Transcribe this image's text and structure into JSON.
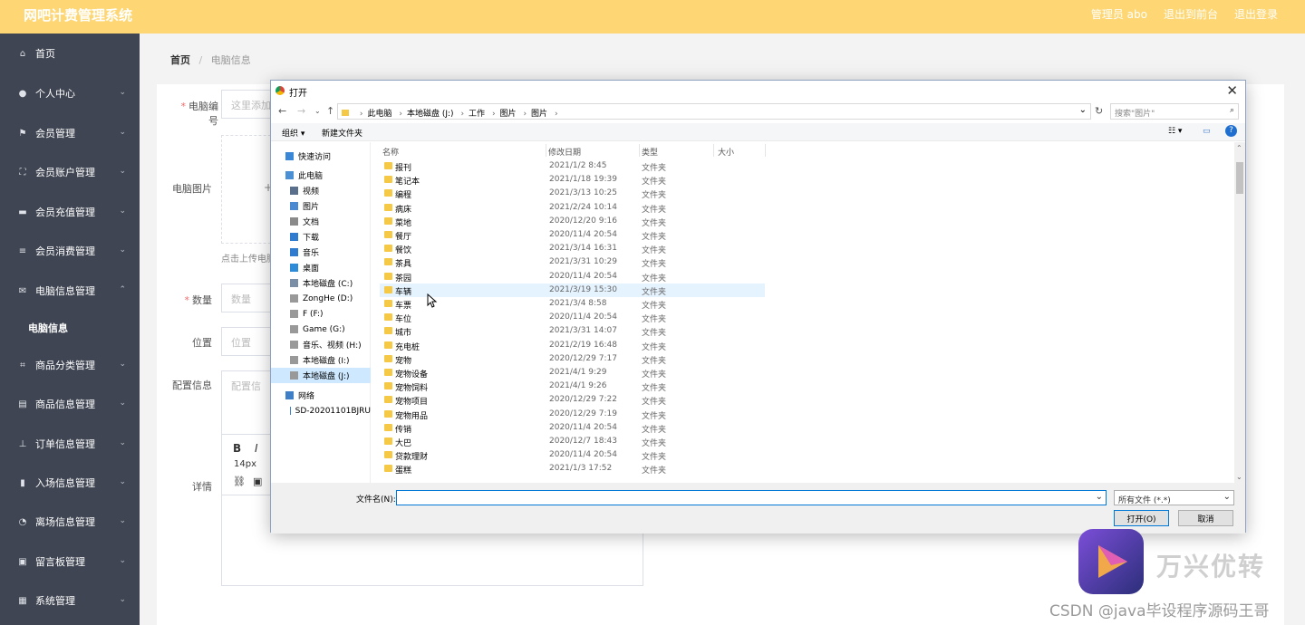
{
  "header": {
    "title": "网吧计费管理系统",
    "links": [
      "管理员 abo",
      "退出到前台",
      "退出登录"
    ]
  },
  "sidebar": {
    "items": [
      {
        "label": "首页",
        "icon": "home-icon",
        "glyph": "⌂"
      },
      {
        "label": "个人中心",
        "icon": "user-icon",
        "glyph": "●"
      },
      {
        "label": "会员管理",
        "icon": "flag-icon",
        "glyph": "⚑"
      },
      {
        "label": "会员账户管理",
        "icon": "frame-icon",
        "glyph": "⛶"
      },
      {
        "label": "会员充值管理",
        "icon": "briefcase-icon",
        "glyph": "▬"
      },
      {
        "label": "会员消费管理",
        "icon": "menu-icon",
        "glyph": "≡"
      },
      {
        "label": "电脑信息管理",
        "icon": "mail-icon",
        "glyph": "✉"
      },
      {
        "label": "商品分类管理",
        "icon": "crop-icon",
        "glyph": "⌗"
      },
      {
        "label": "商品信息管理",
        "icon": "clipboard-icon",
        "glyph": "▤"
      },
      {
        "label": "订单信息管理",
        "icon": "stamp-icon",
        "glyph": "⊥"
      },
      {
        "label": "入场信息管理",
        "icon": "bar-chart-icon",
        "glyph": "▮"
      },
      {
        "label": "离场信息管理",
        "icon": "gauge-icon",
        "glyph": "◔"
      },
      {
        "label": "留言板管理",
        "icon": "briefcase-icon",
        "glyph": "▣"
      },
      {
        "label": "系统管理",
        "icon": "grid-icon",
        "glyph": "▦"
      }
    ],
    "sub_item": "电脑信息"
  },
  "breadcrumb": {
    "home": "首页",
    "separator": "/",
    "current": "电脑信息"
  },
  "form": {
    "computer_no_label": "电脑编号",
    "computer_no_placeholder": "这里添加",
    "image_label": "电脑图片",
    "upload_hint": "点击上传电脑",
    "quantity_label": "数量",
    "quantity_placeholder": "数量",
    "location_label": "位置",
    "location_placeholder": "位置",
    "config_label": "配置信息",
    "config_placeholder": "配置信",
    "detail_label": "详情",
    "font_size": "14px",
    "bold": "B",
    "italic": "I"
  },
  "dialog": {
    "title": "打开",
    "address": [
      "此电脑",
      "本地磁盘 (J:)",
      "工作",
      "图片",
      "图片"
    ],
    "search_placeholder": "搜索\"图片\"",
    "toolbar": {
      "organize": "组织 ▾",
      "new_folder": "新建文件夹"
    },
    "nav": [
      {
        "label": "快速访问",
        "level": 0,
        "color": "#3a87d8"
      },
      {
        "label": "此电脑",
        "level": 0,
        "color": "#4b8fd4"
      },
      {
        "label": "视频",
        "level": 1,
        "color": "#5a6f8c"
      },
      {
        "label": "图片",
        "level": 1,
        "color": "#4a8ad2"
      },
      {
        "label": "文档",
        "level": 1,
        "color": "#8a8a8a"
      },
      {
        "label": "下载",
        "level": 1,
        "color": "#2f7bd0"
      },
      {
        "label": "音乐",
        "level": 1,
        "color": "#2f7bd0"
      },
      {
        "label": "桌面",
        "level": 1,
        "color": "#2d8bd8"
      },
      {
        "label": "本地磁盘 (C:)",
        "level": 1,
        "color": "#7a8fa6"
      },
      {
        "label": "ZongHe (D:)",
        "level": 1,
        "color": "#999999"
      },
      {
        "label": "F (F:)",
        "level": 1,
        "color": "#999999"
      },
      {
        "label": "Game (G:)",
        "level": 1,
        "color": "#999999"
      },
      {
        "label": "音乐、视频 (H:)",
        "level": 1,
        "color": "#999999"
      },
      {
        "label": "本地磁盘 (I:)",
        "level": 1,
        "color": "#999999"
      },
      {
        "label": "本地磁盘 (J:)",
        "level": 1,
        "color": "#999999",
        "selected": true
      },
      {
        "label": "网络",
        "level": 0,
        "color": "#3f7fc8"
      },
      {
        "label": "SD-20201101BJRU",
        "level": 1,
        "color": "#3f7fc8"
      }
    ],
    "columns": [
      "名称",
      "修改日期",
      "类型",
      "大小"
    ],
    "files": [
      {
        "name": "报刊",
        "date": "2021/1/2 8:45",
        "type": "文件夹"
      },
      {
        "name": "笔记本",
        "date": "2021/1/18 19:39",
        "type": "文件夹"
      },
      {
        "name": "编程",
        "date": "2021/3/13 10:25",
        "type": "文件夹"
      },
      {
        "name": "病床",
        "date": "2021/2/24 10:14",
        "type": "文件夹"
      },
      {
        "name": "菜地",
        "date": "2020/12/20 9:16",
        "type": "文件夹"
      },
      {
        "name": "餐厅",
        "date": "2020/11/4 20:54",
        "type": "文件夹"
      },
      {
        "name": "餐饮",
        "date": "2021/3/14 16:31",
        "type": "文件夹"
      },
      {
        "name": "茶具",
        "date": "2021/3/31 10:29",
        "type": "文件夹"
      },
      {
        "name": "茶园",
        "date": "2020/11/4 20:54",
        "type": "文件夹"
      },
      {
        "name": "车辆",
        "date": "2021/3/19 15:30",
        "type": "文件夹",
        "hover": true
      },
      {
        "name": "车票",
        "date": "2021/3/4 8:58",
        "type": "文件夹"
      },
      {
        "name": "车位",
        "date": "2020/11/4 20:54",
        "type": "文件夹"
      },
      {
        "name": "城市",
        "date": "2021/3/31 14:07",
        "type": "文件夹"
      },
      {
        "name": "充电桩",
        "date": "2021/2/19 16:48",
        "type": "文件夹"
      },
      {
        "name": "宠物",
        "date": "2020/12/29 7:17",
        "type": "文件夹"
      },
      {
        "name": "宠物设备",
        "date": "2021/4/1 9:29",
        "type": "文件夹"
      },
      {
        "name": "宠物饲料",
        "date": "2021/4/1 9:26",
        "type": "文件夹"
      },
      {
        "name": "宠物项目",
        "date": "2020/12/29 7:22",
        "type": "文件夹"
      },
      {
        "name": "宠物用品",
        "date": "2020/12/29 7:19",
        "type": "文件夹"
      },
      {
        "name": "传销",
        "date": "2020/11/4 20:54",
        "type": "文件夹"
      },
      {
        "name": "大巴",
        "date": "2020/12/7 18:43",
        "type": "文件夹"
      },
      {
        "name": "贷款理财",
        "date": "2020/11/4 20:54",
        "type": "文件夹"
      },
      {
        "name": "蛋糕",
        "date": "2021/1/3 17:52",
        "type": "文件夹"
      }
    ],
    "filename_label": "文件名(N):",
    "filename_value": "",
    "filetype": "所有文件 (*.*)",
    "open_label": "打开(O)",
    "cancel_label": "取消"
  },
  "watermark": {
    "brand": "万兴优转",
    "credit": "CSDN @java毕设程序源码王哥"
  }
}
